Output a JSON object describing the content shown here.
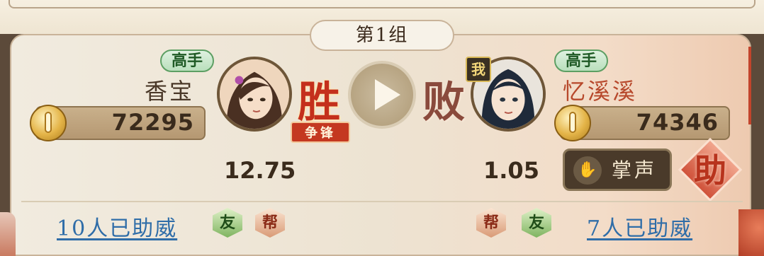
{
  "group": {
    "title": "第1组"
  },
  "left_player": {
    "rank_tag": "高手",
    "name": "香宝",
    "power": "72295",
    "result": "胜",
    "result_badge": "争锋",
    "odds": "12.75",
    "cheer_link": "10人已助威",
    "badges": [
      "友",
      "帮"
    ]
  },
  "right_player": {
    "self_mark": "我",
    "rank_tag": "高手",
    "name": "忆溪溪",
    "power": "74346",
    "result": "败",
    "odds": "1.05",
    "cheer_link": "7人已助威",
    "badges": [
      "帮",
      "友"
    ]
  },
  "actions": {
    "applaud_label": "掌声",
    "help_label": "助"
  },
  "colors": {
    "win_red": "#c4301c",
    "link_blue": "#2f6da8",
    "tag_green": "#5d9f63"
  },
  "icons": {
    "power": "sword-medal-icon",
    "play": "play-icon",
    "applaud": "clapping-hands-icon"
  }
}
